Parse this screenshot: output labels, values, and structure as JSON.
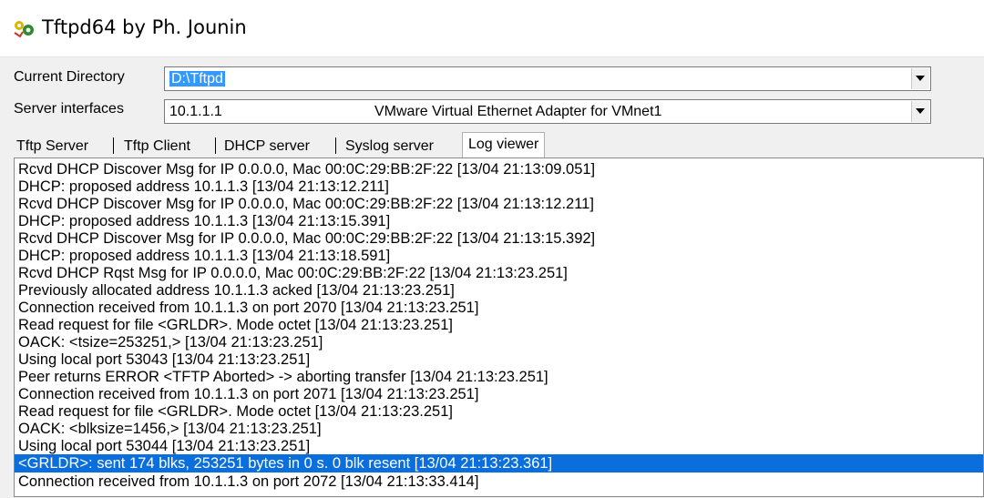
{
  "window": {
    "title": "Tftpd64 by Ph. Jounin",
    "icon": "tftpd-app-icon"
  },
  "fields": {
    "current_directory": {
      "label": "Current Directory",
      "value": "D:\\Tftpd"
    },
    "server_interfaces": {
      "label": "Server interfaces",
      "ip": "10.1.1.1",
      "adapter": "VMware Virtual Ethernet Adapter for VMnet1"
    }
  },
  "tabs": [
    {
      "label": "Tftp Server"
    },
    {
      "label": "Tftp Client"
    },
    {
      "label": "DHCP server"
    },
    {
      "label": "Syslog server"
    },
    {
      "label": "Log viewer",
      "active": true
    }
  ],
  "log": [
    "Rcvd DHCP Discover Msg for IP 0.0.0.0, Mac 00:0C:29:BB:2F:22 [13/04 21:13:09.051]",
    "DHCP: proposed address 10.1.1.3 [13/04 21:13:12.211]",
    "Rcvd DHCP Discover Msg for IP 0.0.0.0, Mac 00:0C:29:BB:2F:22 [13/04 21:13:12.211]",
    "DHCP: proposed address 10.1.1.3 [13/04 21:13:15.391]",
    "Rcvd DHCP Discover Msg for IP 0.0.0.0, Mac 00:0C:29:BB:2F:22 [13/04 21:13:15.392]",
    "DHCP: proposed address 10.1.1.3 [13/04 21:13:18.591]",
    "Rcvd DHCP Rqst Msg for IP 0.0.0.0, Mac 00:0C:29:BB:2F:22 [13/04 21:13:23.251]",
    "Previously allocated address 10.1.1.3 acked [13/04 21:13:23.251]",
    "Connection received from 10.1.1.3 on port 2070 [13/04 21:13:23.251]",
    "Read request for file <GRLDR>. Mode octet [13/04 21:13:23.251]",
    "OACK: <tsize=253251,> [13/04 21:13:23.251]",
    "Using local port 53043 [13/04 21:13:23.251]",
    "Peer returns ERROR <TFTP Aborted> -> aborting transfer [13/04 21:13:23.251]",
    "Connection received from 10.1.1.3 on port 2071 [13/04 21:13:23.251]",
    "Read request for file <GRLDR>. Mode octet [13/04 21:13:23.251]",
    "OACK: <blksize=1456,> [13/04 21:13:23.251]",
    "Using local port 53044 [13/04 21:13:23.251]",
    "<GRLDR>: sent 174 blks, 253251 bytes in 0 s. 0 blk resent [13/04 21:13:23.361]",
    "Connection received from 10.1.1.3 on port 2072 [13/04 21:13:33.414]"
  ],
  "selected_log_index": 17,
  "colors": {
    "selection": "#0a6edc",
    "text_selection": "#3399ff",
    "window_bg": "#f0f0f0"
  }
}
